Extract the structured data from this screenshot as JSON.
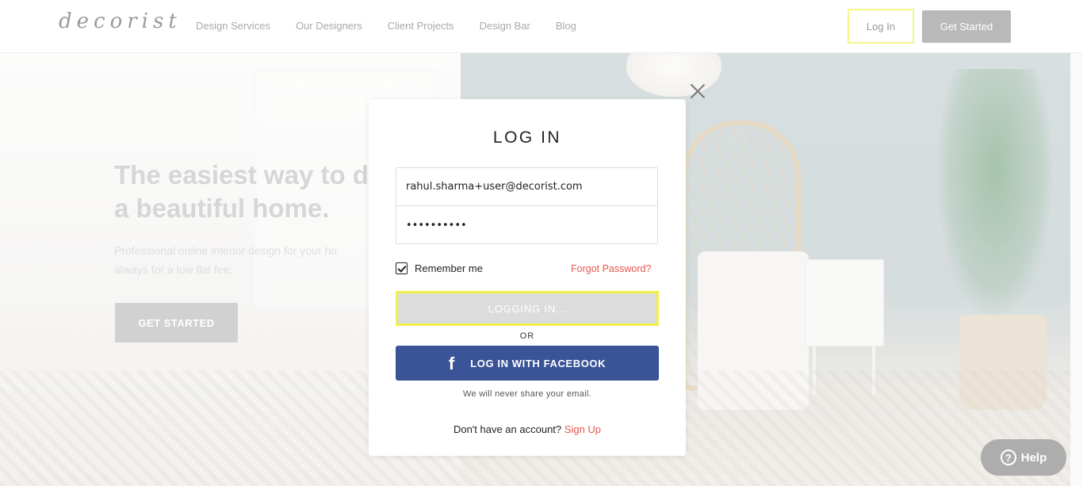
{
  "header": {
    "logo": "decorist",
    "nav": [
      "Design Services",
      "Our Designers",
      "Client Projects",
      "Design Bar",
      "Blog"
    ],
    "login_label": "Log In",
    "get_started_label": "Get Started"
  },
  "hero": {
    "title_line1": "The easiest way to desig",
    "title_line2": "a beautiful home.",
    "subtitle_line1": "Professional online interior design for your ho",
    "subtitle_line2": "always for a low flat fee.",
    "cta_label": "GET STARTED"
  },
  "modal": {
    "title": "LOG IN",
    "email_value": "rahul.sharma+user@decorist.com",
    "password_value": "••••••••••",
    "remember_label": "Remember me",
    "remember_checked": true,
    "forgot_label": "Forgot Password?",
    "submit_label": "LOGGING IN...",
    "or_label": "OR",
    "facebook_icon": "f",
    "facebook_label": "LOG IN WITH FACEBOOK",
    "privacy_note": "We will never share your email.",
    "signup_prompt": "Don't have an account?",
    "signup_link": "Sign Up"
  },
  "help": {
    "icon": "?",
    "label": "Help"
  },
  "colors": {
    "accent_red": "#e8554e",
    "facebook_blue": "#3a5497",
    "focus_yellow": "#f3f04a"
  }
}
